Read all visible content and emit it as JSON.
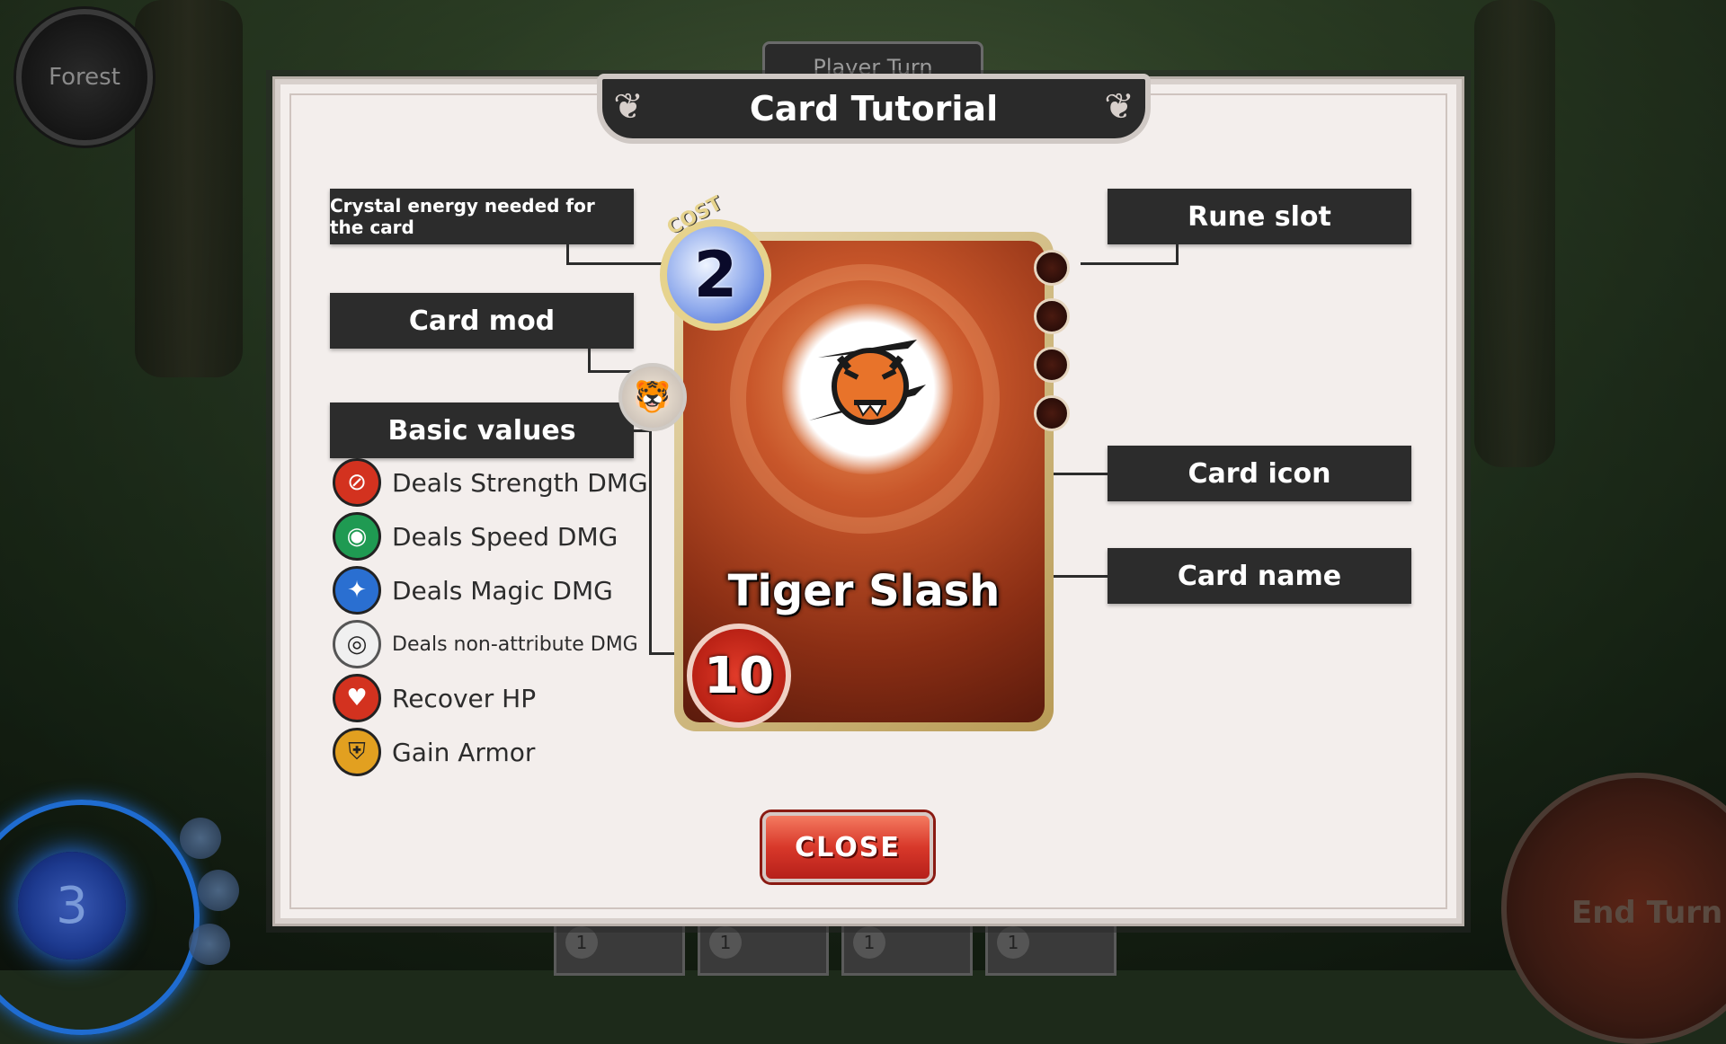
{
  "hud": {
    "location": "Forest",
    "turn": "Player Turn",
    "energy": "3",
    "end_turn": "End Turn",
    "hand_costs": [
      "1",
      "1",
      "1",
      "1"
    ]
  },
  "modal": {
    "title": "Card Tutorial",
    "labels": {
      "cost": "Crystal energy needed for the card",
      "card_mod": "Card mod",
      "basic_values": "Basic values",
      "rune_slot": "Rune slot",
      "card_icon": "Card icon",
      "card_name": "Card name"
    },
    "legend": [
      {
        "text": "Deals Strength DMG",
        "icon": "strength-icon",
        "color": "#d3321f"
      },
      {
        "text": "Deals Speed DMG",
        "icon": "speed-icon",
        "color": "#1f9a52"
      },
      {
        "text": "Deals Magic DMG",
        "icon": "magic-icon",
        "color": "#2a6fd1"
      },
      {
        "text": "Deals non-attribute DMG",
        "icon": "non-attribute-icon",
        "color": "#6a6a6a"
      },
      {
        "text": "Recover HP",
        "icon": "heart-icon",
        "color": "#d3321f"
      },
      {
        "text": "Gain Armor",
        "icon": "shield-icon",
        "color": "#e2a020"
      }
    ],
    "close_label": "CLOSE"
  },
  "card": {
    "cost_tag": "COST",
    "cost": "2",
    "name": "Tiger Slash",
    "value": "10",
    "icon": "tiger-icon",
    "rune_slots": 4
  }
}
